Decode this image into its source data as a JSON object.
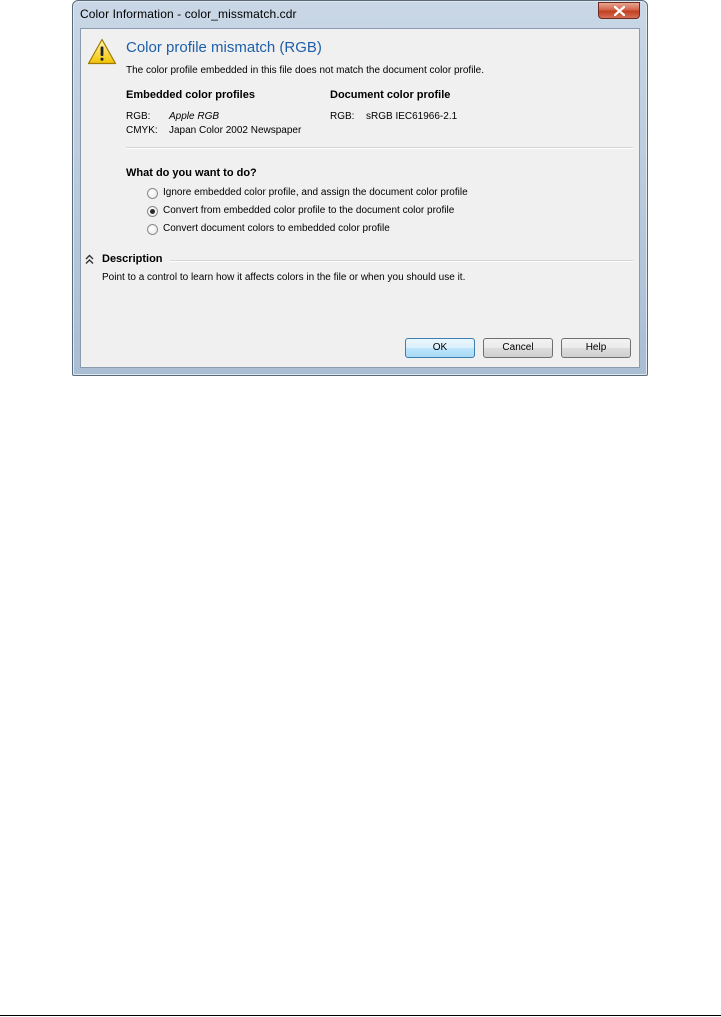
{
  "window": {
    "title": "Color Information - color_missmatch.cdr"
  },
  "header": {
    "heading": "Color profile mismatch (RGB)",
    "message": "The color profile embedded in this file does not match the document color profile."
  },
  "embedded": {
    "title": "Embedded color profiles",
    "rows": [
      {
        "key": "RGB:",
        "value": "Apple RGB"
      },
      {
        "key": "CMYK:",
        "value": "Japan Color 2002 Newspaper"
      }
    ]
  },
  "document": {
    "title": "Document color profile",
    "rows": [
      {
        "key": "RGB:",
        "value": "sRGB IEC61966-2.1"
      }
    ]
  },
  "question": {
    "title": "What do you want to do?",
    "options": [
      {
        "label": "Ignore embedded color profile, and assign the document color profile",
        "checked": false
      },
      {
        "label": "Convert from embedded color profile to the document color profile",
        "checked": true
      },
      {
        "label": "Convert document colors to embedded color profile",
        "checked": false
      }
    ]
  },
  "description": {
    "title": "Description",
    "text": "Point to a control to learn how it affects colors in the file or when you should use it."
  },
  "buttons": {
    "ok": "OK",
    "cancel": "Cancel",
    "help": "Help"
  },
  "icons": {
    "warning": "warning-icon",
    "close": "close-icon",
    "collapse": "double-chevron-up-icon"
  },
  "colors": {
    "heading": "#1e5fa8",
    "close_button": "#c2401f"
  }
}
